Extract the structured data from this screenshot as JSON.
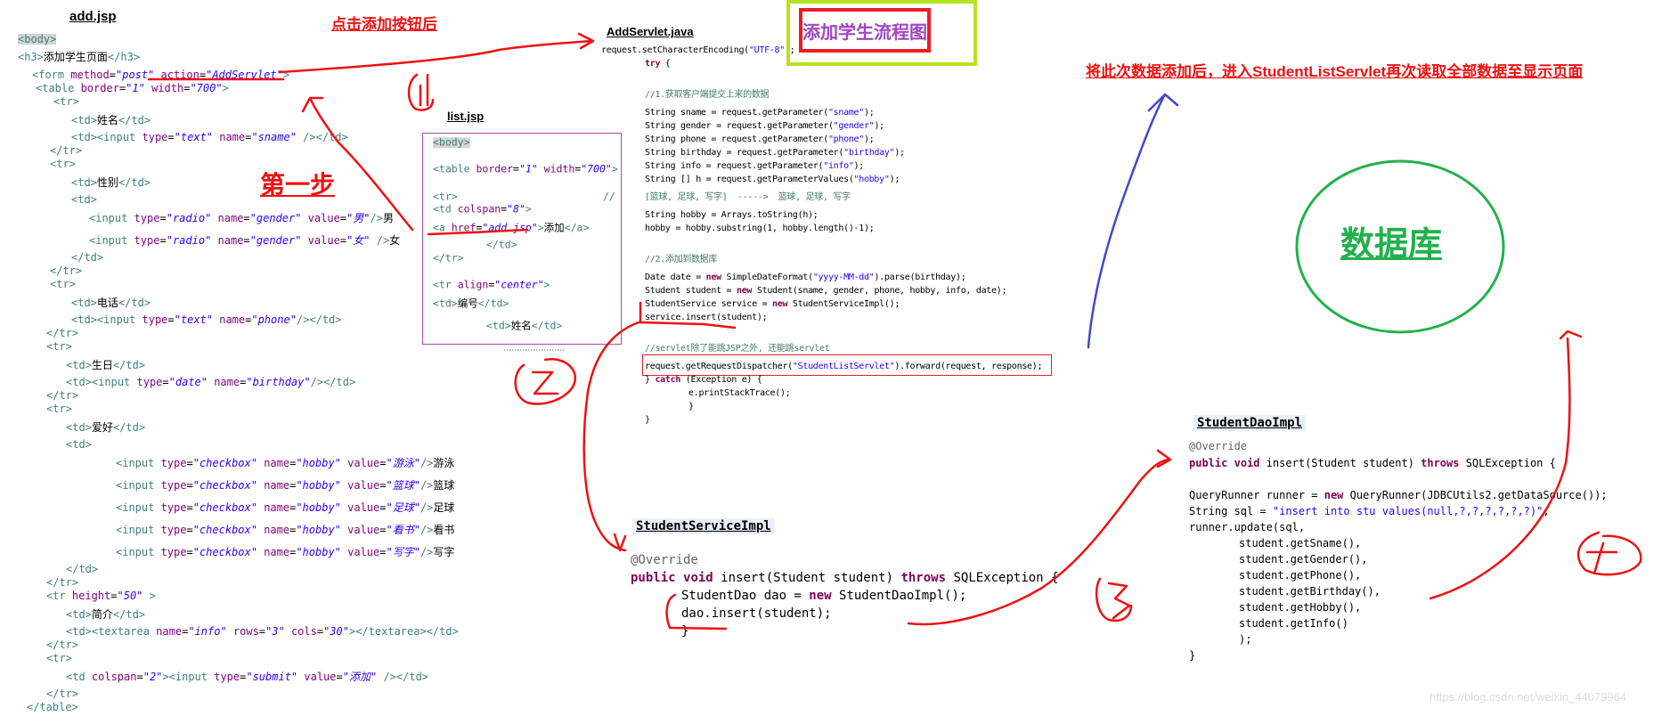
{
  "flow_title": "添加学生流程图",
  "notes": {
    "click_add": "点击添加按钮后",
    "step_one": "第一步",
    "after_add": "将此次数据添加后，进入StudentListServlet再次读取全部数据至显示页面",
    "database": "数据库",
    "step_marks": [
      "1",
      "2",
      "3",
      "4"
    ]
  },
  "colors": {
    "annotation_red": "#ee1111",
    "arrow_blue": "#3f48cc",
    "database_green": "#22b14c",
    "frame_green": "#b5e31e",
    "flow_title_purple": "#a047c0"
  },
  "add_jsp": {
    "title": "add.jsp",
    "lines": [
      "<body>",
      "<h3>添加学生页面</h3>",
      "<form method=\"post\" action=\"AddServlet\">",
      "<table border=\"1\" width=\"700\">",
      "<tr>",
      "<td>姓名</td>",
      "<td><input type=\"text\" name=\"sname\" /></td>",
      "</tr>",
      "<tr>",
      "<td>性别</td>",
      "<td>",
      "<input type=\"radio\" name=\"gender\" value=\"男\"/>男",
      "<input type=\"radio\" name=\"gender\" value=\"女\" />女",
      "</td>",
      "</tr>",
      "<tr>",
      "<td>电话</td>",
      "<td><input type=\"text\" name=\"phone\"/></td>",
      "</tr>",
      "<tr>",
      "<td>生日</td>",
      "<td><input type=\"date\" name=\"birthday\"/></td>",
      "</tr>",
      "<tr>",
      "<td>爱好</td>",
      "<td>",
      "<input type=\"checkbox\" name=\"hobby\" value=\"游泳\"/>游泳",
      "<input type=\"checkbox\" name=\"hobby\" value=\"篮球\"/>篮球",
      "<input type=\"checkbox\" name=\"hobby\" value=\"足球\"/>足球",
      "<input type=\"checkbox\" name=\"hobby\" value=\"看书\"/>看书",
      "<input type=\"checkbox\" name=\"hobby\" value=\"写字\"/>写字",
      "</td>",
      "</tr>",
      "<tr height=\"50\" >",
      "<td>简介</td>",
      "<td><textarea name=\"info\" rows=\"3\" cols=\"30\"></textarea></td>",
      "</tr>",
      "<tr>",
      "<td colspan=\"2\"><input type=\"submit\" value=\"添加\" /></td>",
      "</tr>",
      "</table>"
    ]
  },
  "list_jsp": {
    "title": "list.jsp",
    "lines": [
      "<body>",
      "<table border=\"1\" width=\"700\">",
      "<tr>",
      "<td colspan=\"8\">",
      "<a href=\"add.jsp\">添加</a>",
      "</td>",
      "</tr>",
      "<tr align=\"center\">",
      "<td>编号</td>",
      "<td>姓名</td>"
    ],
    "comment_mark": "//"
  },
  "add_servlet": {
    "title": "AddServlet.java",
    "lines": [
      "request.setCharacterEncoding(\"UTF-8\");",
      "try {",
      "//1.获取客户端提交上来的数据",
      "String sname = request.getParameter(\"sname\");",
      "String gender = request.getParameter(\"gender\");",
      "String phone = request.getParameter(\"phone\");",
      "String birthday = request.getParameter(\"birthday\");",
      "String info = request.getParameter(\"info\");",
      "String [] h = request.getParameterValues(\"hobby\");",
      "[篮球, 足球, 写字]  ----->  篮球, 足球, 写字",
      "String hobby = Arrays.toString(h);",
      "hobby = hobby.substring(1, hobby.length()-1);",
      "//2.添加到数据库",
      "Date date = new SimpleDateFormat(\"yyyy-MM-dd\").parse(birthday);",
      "Student student = new Student(sname, gender, phone, hobby, info, date);",
      "StudentService service = new StudentServiceImpl();",
      "service.insert(student);",
      "//servlet除了能跳JSP之外, 还能跳servlet",
      "request.getRequestDispatcher(\"StudentListServlet\").forward(request, response);",
      "} catch (Exception e) {",
      "e.printStackTrace();",
      "}",
      "}"
    ]
  },
  "student_service_impl": {
    "title": "StudentServiceImpl",
    "lines": [
      "@Override",
      "public void insert(Student student) throws SQLException {",
      "StudentDao dao = new StudentDaoImpl();",
      "dao.insert(student);",
      "}"
    ]
  },
  "student_dao_impl": {
    "title": "StudentDaoImpl",
    "lines": [
      "@Override",
      "public void insert(Student student) throws SQLException {",
      "QueryRunner runner = new QueryRunner(JDBCUtils2.getDataSource());",
      "String sql = \"insert into stu values(null,?,?,?,?,?,?)\";",
      "runner.update(sql,",
      "student.getSname(),",
      "student.getGender(),",
      "student.getPhone(),",
      "student.getBirthday(),",
      "student.getHobby(),",
      "student.getInfo()",
      ");",
      "}"
    ]
  },
  "watermark": "https://blog.csdn.net/weixin_44079964"
}
